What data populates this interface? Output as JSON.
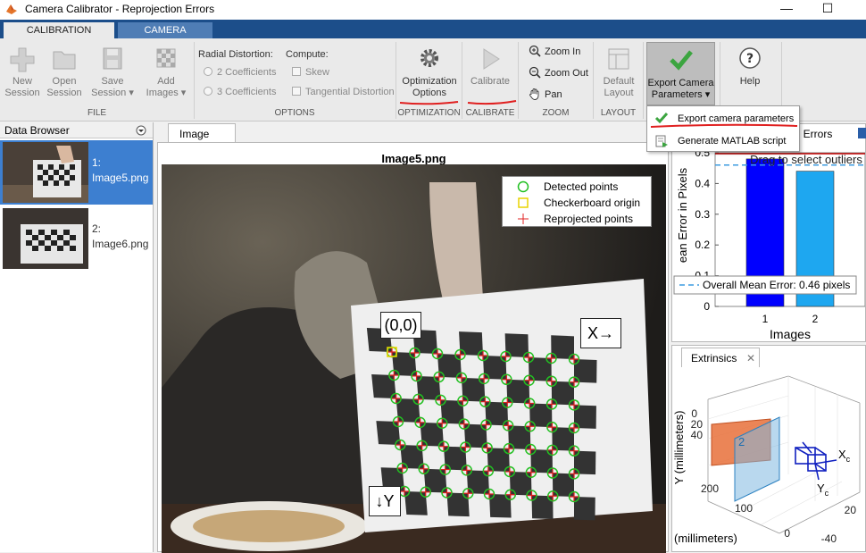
{
  "window": {
    "title": "Camera Calibrator - Reprojection Errors",
    "minimize_glyph": "—",
    "maximize_glyph": "☐"
  },
  "tabs": [
    {
      "label": "CALIBRATION",
      "active": true
    },
    {
      "label": "CAMERA",
      "active": false
    }
  ],
  "ribbon": {
    "file": {
      "group_label": "FILE",
      "new_session": [
        "New",
        "Session"
      ],
      "open_session": [
        "Open",
        "Session"
      ],
      "save_session": [
        "Save",
        "Session ▾"
      ],
      "add_images": [
        "Add",
        "Images ▾"
      ]
    },
    "options": {
      "group_label": "OPTIONS",
      "radial_label": "Radial Distortion:",
      "compute_label": "Compute:",
      "radial_choices": [
        "2 Coefficients",
        "3 Coefficients"
      ],
      "compute_choices": [
        "Skew",
        "Tangential Distortion"
      ]
    },
    "optimization": {
      "group_label": "OPTIMIZATION",
      "button": [
        "Optimization",
        "Options"
      ]
    },
    "calibrate": {
      "group_label": "CALIBRATE",
      "button": "Calibrate"
    },
    "zoom": {
      "group_label": "ZOOM",
      "zoom_in": "Zoom In",
      "zoom_out": "Zoom Out",
      "pan": "Pan"
    },
    "layout": {
      "group_label": "LAYOUT",
      "button": [
        "Default",
        "Layout"
      ]
    },
    "export": {
      "button": [
        "Export Camera",
        "Parameters ▾"
      ]
    },
    "help": {
      "button": "Help"
    }
  },
  "export_menu": {
    "items": [
      "Export camera parameters",
      "Generate MATLAB script"
    ]
  },
  "data_browser": {
    "title": "Data Browser",
    "items": [
      {
        "label": "1:\nImage5.png",
        "selected": true
      },
      {
        "label": "2:\nImage6.png",
        "selected": false
      }
    ]
  },
  "image_panel": {
    "tab_label": "Image",
    "title": "Image5.png",
    "legend": [
      "Detected points",
      "Checkerboard origin",
      "Reprojected points"
    ],
    "origin_label": "(0,0)",
    "x_label": "X→",
    "y_label": "↓Y"
  },
  "reprojection_panel": {
    "tab_label": "ction Errors",
    "ylabel": "ean Error in Pixels",
    "xlabel": "Images",
    "overlay_text": "Drag to select outliers",
    "mean_label": "Overall Mean Error: 0.46 pixels",
    "colors": {
      "selected": "#0000ff",
      "other": "#1ea7f0",
      "mean_line": "#3c9be0"
    }
  },
  "extrinsics_panel": {
    "tab_label": "Extrinsics",
    "close_glyph": "✕",
    "y_axis_label": "Y (millimeters)",
    "bottom_label": "(millimeters)",
    "y_ticks": [
      "0",
      "20",
      "40",
      "200"
    ],
    "depth_ticks": [
      "100",
      "0"
    ],
    "x_ticks": [
      "20",
      "-40"
    ],
    "camera_axes": {
      "x": "X",
      "y": "Y",
      "sub": "c"
    },
    "board_id": "2"
  },
  "chart_data": {
    "type": "bar",
    "categories": [
      "1",
      "2"
    ],
    "values": [
      0.48,
      0.44
    ],
    "mean": 0.46,
    "ylim": [
      0,
      0.5
    ],
    "yticks": [
      "0",
      "0.1",
      "0.2",
      "0.3",
      "0.4",
      "0.5"
    ],
    "xlabel": "Images",
    "ylabel": "ean Error in Pixels",
    "legend": "Overall Mean Error: 0.46 pixels"
  }
}
